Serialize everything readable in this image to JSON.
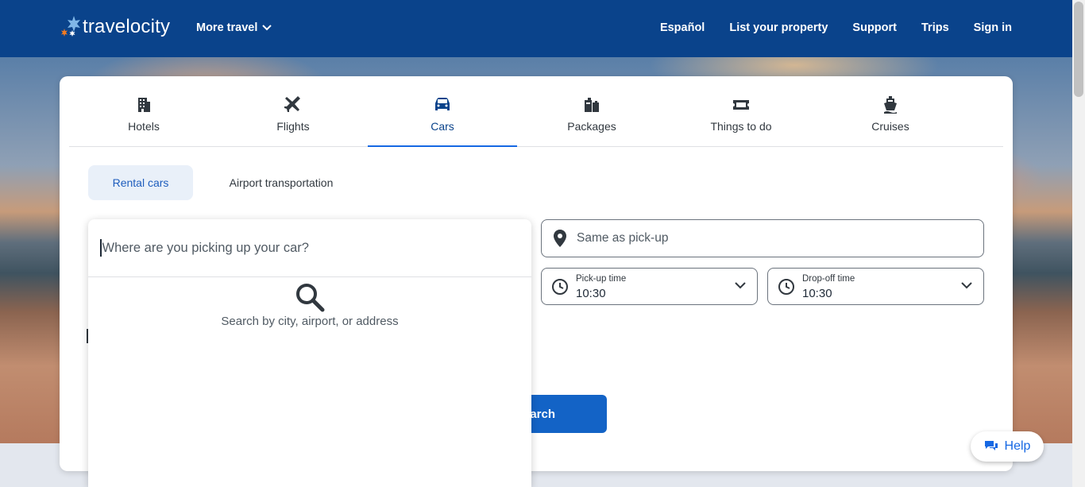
{
  "header": {
    "logo_text": "travelocity",
    "more_travel": "More travel",
    "nav": [
      "Español",
      "List your property",
      "Support",
      "Trips",
      "Sign in"
    ]
  },
  "tabs": [
    {
      "label": "Hotels",
      "icon": "building-icon"
    },
    {
      "label": "Flights",
      "icon": "plane-icon"
    },
    {
      "label": "Cars",
      "icon": "car-icon",
      "active": true
    },
    {
      "label": "Packages",
      "icon": "luggage-icon"
    },
    {
      "label": "Things to do",
      "icon": "ticket-icon"
    },
    {
      "label": "Cruises",
      "icon": "ship-icon"
    }
  ],
  "subtabs": {
    "rental": "Rental cars",
    "airport": "Airport transportation"
  },
  "pickup": {
    "placeholder": "Where are you picking up your car?",
    "hint": "Search by city, airport, or address"
  },
  "dropoff": {
    "placeholder": "Same as pick-up"
  },
  "times": {
    "pickup_label": "Pick-up time",
    "pickup_value": "10:30",
    "dropoff_label": "Drop-off time",
    "dropoff_value": "10:30"
  },
  "search_label": "arch",
  "help_label": "Help",
  "colors": {
    "header": "#0a438b",
    "accent": "#1668e3",
    "button": "#1363c6"
  }
}
